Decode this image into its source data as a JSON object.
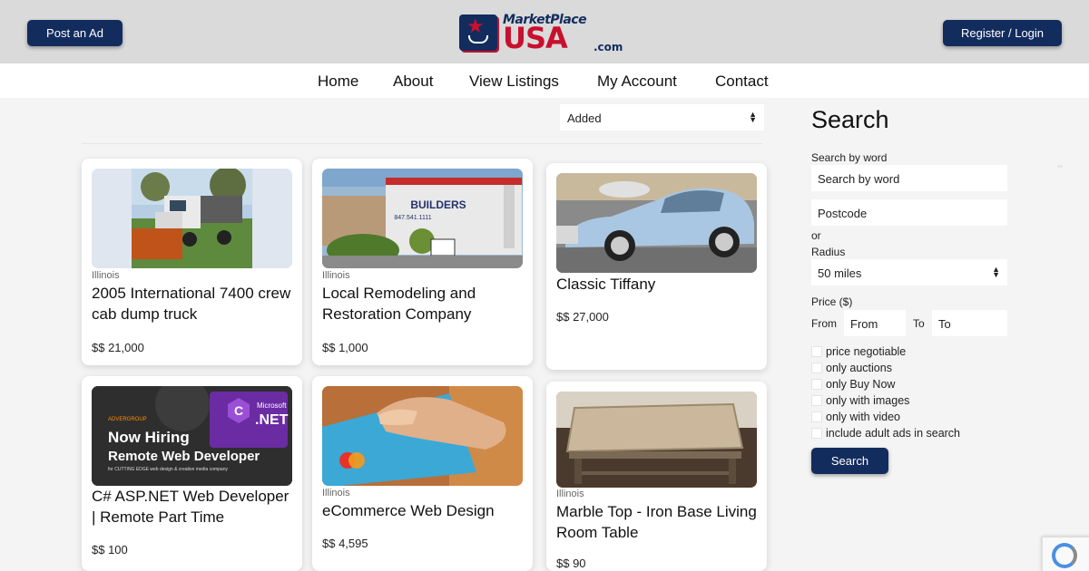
{
  "header": {
    "post_ad": "Post an Ad",
    "register_login": "Register / Login",
    "logo": {
      "top": "MarketPlace",
      "main": "USA",
      "suffix": ".com"
    }
  },
  "nav": [
    "Home",
    "About",
    "View Listings",
    "My Account",
    "Contact"
  ],
  "sort": {
    "selected": "Added"
  },
  "listings": [
    {
      "location": "Illinois",
      "title": "2005 International 7400 crew cab dump truck",
      "price": "$$ 21,000"
    },
    {
      "location": "Illinois",
      "title": "Local Remodeling and Restoration Company",
      "price": "$$ 1,000"
    },
    {
      "location": "",
      "title": "Classic Tiffany",
      "price": "$$ 27,000"
    },
    {
      "location": "",
      "title": "C# ASP.NET Web Developer | Remote Part Time",
      "price": "$$ 100",
      "image_text": {
        "brand": "ADVERGROUP",
        "line1": "Now Hiring",
        "line2": "Remote Web Developer",
        "line3": "for CUTTING EDGE web design & creative media company",
        "badge1": "Microsoft",
        "badge2": ".NET"
      }
    },
    {
      "location": "Illinois",
      "title": "eCommerce Web Design",
      "price": "$$ 4,595"
    },
    {
      "location": "Illinois",
      "title": "Marble Top - Iron Base Living Room Table",
      "price": "$$ 90"
    }
  ],
  "listing_images": {
    "builders_sign": "BUILDERS",
    "builders_phone": "847.541.1111"
  },
  "sidebar": {
    "title": "Search",
    "word_label": "Search by word",
    "word_placeholder": "Search by word",
    "postcode_placeholder": "Postcode",
    "or": "or",
    "radius_label": "Radius",
    "radius_value": "50 miles",
    "price_label": "Price ($)",
    "from_label": "From",
    "from_placeholder": "From",
    "to_label": "To",
    "to_placeholder": "To",
    "checks": [
      "price negotiable",
      "only auctions",
      "only Buy Now",
      "only with images",
      "only with video",
      "include adult ads in search"
    ],
    "search_button": "Search"
  },
  "colors": {
    "brand_navy": "#132c5e",
    "brand_red": "#c8102e",
    "header_bg": "#dadada",
    "page_bg": "#f4f4f4"
  }
}
